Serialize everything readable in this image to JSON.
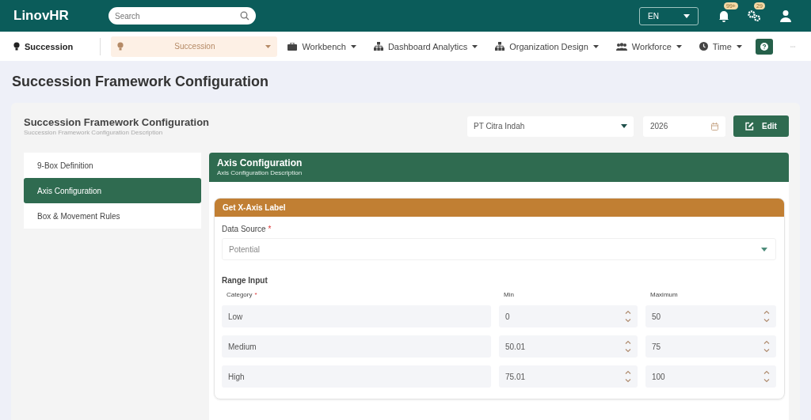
{
  "app": {
    "logo": "LinovHR",
    "search": {
      "placeholder": "Search"
    },
    "language": "EN",
    "notifications": "99+",
    "settings_badge": "29"
  },
  "nav": {
    "module": "Succession",
    "items": [
      {
        "label": "Succession",
        "selected": true
      },
      {
        "label": "Workbench",
        "selected": false
      },
      {
        "label": "Dashboard Analytics",
        "selected": false
      },
      {
        "label": "Organization Design",
        "selected": false
      },
      {
        "label": "Workforce",
        "selected": false
      },
      {
        "label": "Time",
        "selected": false
      }
    ]
  },
  "page_title": "Succession Framework Configuration",
  "card": {
    "title": "Succession Framework Configuration",
    "description": "Succession Framework Configuration Description",
    "company": "PT Citra Indah",
    "year": "2026",
    "edit_button": "Edit"
  },
  "menu": [
    {
      "label": "9-Box Definition",
      "selected": false
    },
    {
      "label": "Axis Configuration",
      "selected": true
    },
    {
      "label": "Box & Movement Rules",
      "selected": false
    }
  ],
  "panel": {
    "title": "Axis Configuration",
    "description": "Axis Configuration Description",
    "section": {
      "title": "Get X-Axis Label",
      "data_source": {
        "label": "Data Source",
        "mark": "*",
        "value": "Potential"
      },
      "range": {
        "title": "Range Input",
        "columns": [
          {
            "label": "Category",
            "mark": "*"
          },
          {
            "label": "Min"
          },
          {
            "label": "Maximum"
          }
        ],
        "rows": [
          {
            "category": "Low",
            "min": "0",
            "max": "50"
          },
          {
            "category": "Medium",
            "min": "50.01",
            "max": "75"
          },
          {
            "category": "High",
            "min": "75.01",
            "max": "100"
          }
        ]
      }
    }
  }
}
